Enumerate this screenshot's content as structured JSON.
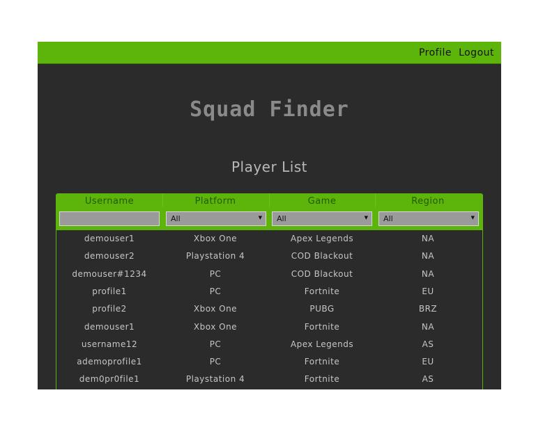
{
  "nav": {
    "profile": "Profile",
    "logout": "Logout"
  },
  "app_title": "Squad Finder",
  "list_title": "Player List",
  "table": {
    "columns": [
      "Username",
      "Platform",
      "Game",
      "Region"
    ],
    "filters": {
      "username": "",
      "platform": "All",
      "game": "All",
      "region": "All"
    },
    "rows": [
      [
        "demouser1",
        "Xbox One",
        "Apex Legends",
        "NA"
      ],
      [
        "demouser2",
        "Playstation 4",
        "COD Blackout",
        "NA"
      ],
      [
        "demouser#1234",
        "PC",
        "COD Blackout",
        "NA"
      ],
      [
        "profile1",
        "PC",
        "Fortnite",
        "EU"
      ],
      [
        "profile2",
        "Xbox One",
        "PUBG",
        "BRZ"
      ],
      [
        "demouser1",
        "Xbox One",
        "Fortnite",
        "NA"
      ],
      [
        "username12",
        "PC",
        "Apex Legends",
        "AS"
      ],
      [
        "ademoprofile1",
        "PC",
        "Fortnite",
        "EU"
      ],
      [
        "dem0pr0file1",
        "Playstation 4",
        "Fortnite",
        "AS"
      ]
    ]
  },
  "colors": {
    "accent": "#5db40a",
    "background": "#2b2b2b",
    "title": "#8a8a8a"
  }
}
